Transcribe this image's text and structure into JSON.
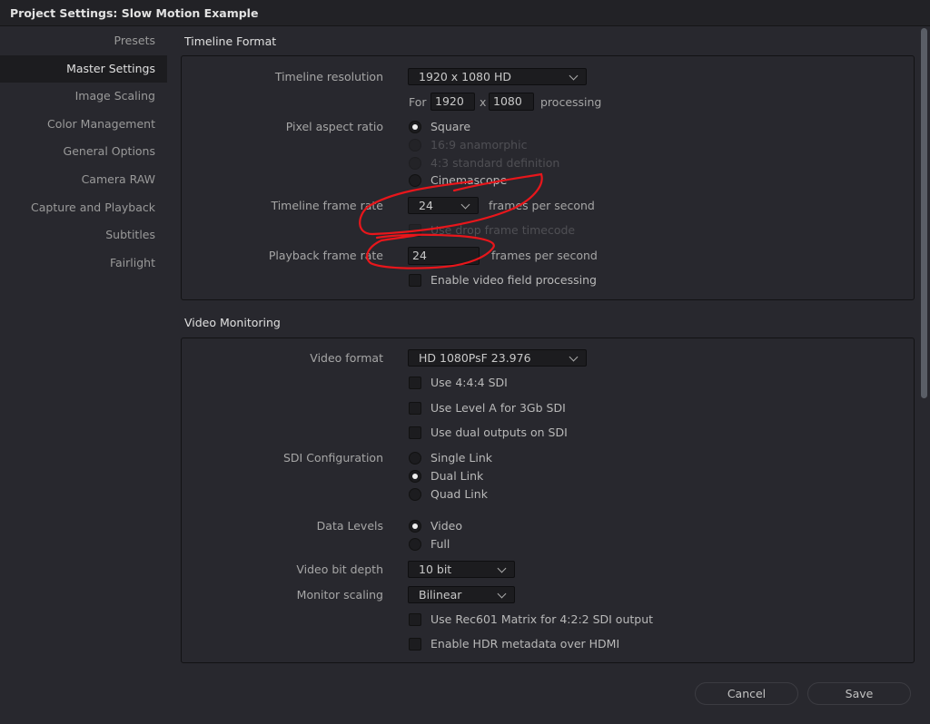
{
  "window": {
    "title": "Project Settings:  Slow Motion Example"
  },
  "sidebar": {
    "items": [
      {
        "label": "Presets",
        "active": false
      },
      {
        "label": "Master Settings",
        "active": true
      },
      {
        "label": "Image Scaling",
        "active": false
      },
      {
        "label": "Color Management",
        "active": false
      },
      {
        "label": "General Options",
        "active": false
      },
      {
        "label": "Camera RAW",
        "active": false
      },
      {
        "label": "Capture and Playback",
        "active": false
      },
      {
        "label": "Subtitles",
        "active": false
      },
      {
        "label": "Fairlight",
        "active": false
      }
    ]
  },
  "timeline_format": {
    "title": "Timeline Format",
    "resolution_label": "Timeline resolution",
    "resolution_value": "1920 x 1080 HD",
    "for_label": "For",
    "width_value": "1920",
    "x_label": "x",
    "height_value": "1080",
    "processing_label": "processing",
    "pixel_aspect_label": "Pixel aspect ratio",
    "pixel_aspect_options": [
      {
        "label": "Square",
        "selected": true,
        "disabled": false
      },
      {
        "label": "16:9 anamorphic",
        "selected": false,
        "disabled": true
      },
      {
        "label": "4:3 standard definition",
        "selected": false,
        "disabled": true
      },
      {
        "label": "Cinemascope",
        "selected": false,
        "disabled": false
      }
    ],
    "frame_rate_label": "Timeline frame rate",
    "frame_rate_value": "24",
    "fps_label": "frames per second",
    "drop_frame_label": "Use drop frame timecode",
    "drop_frame_checked": false,
    "drop_frame_disabled": true,
    "playback_rate_label": "Playback frame rate",
    "playback_rate_value": "24",
    "playback_fps_label": "frames per second",
    "field_processing_label": "Enable video field processing",
    "field_processing_checked": false
  },
  "video_monitoring": {
    "title": "Video Monitoring",
    "video_format_label": "Video format",
    "video_format_value": "HD 1080PsF 23.976",
    "checks_top": [
      {
        "label": "Use 4:4:4 SDI",
        "checked": false
      },
      {
        "label": "Use Level A for 3Gb SDI",
        "checked": false
      },
      {
        "label": "Use dual outputs on SDI",
        "checked": false
      }
    ],
    "sdi_config_label": "SDI Configuration",
    "sdi_options": [
      {
        "label": "Single Link",
        "selected": false
      },
      {
        "label": "Dual Link",
        "selected": true
      },
      {
        "label": "Quad Link",
        "selected": false
      }
    ],
    "data_levels_label": "Data Levels",
    "data_levels_options": [
      {
        "label": "Video",
        "selected": true
      },
      {
        "label": "Full",
        "selected": false
      }
    ],
    "bit_depth_label": "Video bit depth",
    "bit_depth_value": "10 bit",
    "monitor_scaling_label": "Monitor scaling",
    "monitor_scaling_value": "Bilinear",
    "checks_bottom": [
      {
        "label": "Use Rec601 Matrix for 4:2:2 SDI output",
        "checked": false
      },
      {
        "label": "Enable HDR metadata over HDMI",
        "checked": false
      }
    ]
  },
  "footer": {
    "cancel_label": "Cancel",
    "save_label": "Save"
  },
  "annotation": {
    "color": "#e8161b",
    "description": "red freehand circles around frame rate settings"
  }
}
